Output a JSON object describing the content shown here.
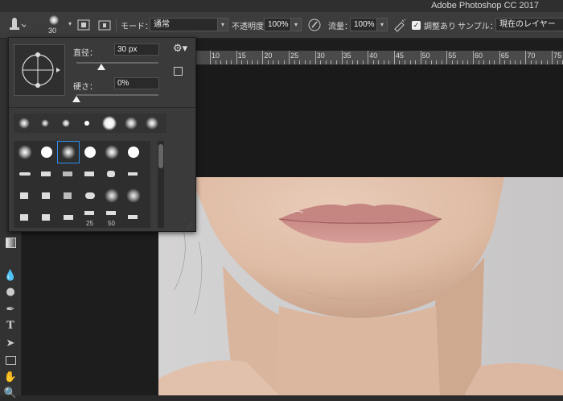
{
  "app": {
    "title": "Adobe Photoshop CC 2017"
  },
  "options_bar": {
    "brush_size": "30",
    "mode_label": "モード：",
    "mode_value": "通常",
    "opacity_label": "不透明度：",
    "opacity_value": "100%",
    "flow_label": "流量：",
    "flow_value": "100%",
    "aligned_label": "調整あり",
    "sample_label": "サンプル：",
    "sample_value": "現在のレイヤー"
  },
  "brush_panel": {
    "diameter_label": "直径：",
    "diameter_value": "30 px",
    "hardness_label": "硬さ：",
    "hardness_value": "0%",
    "diameter_fraction": 0.3,
    "hardness_fraction": 0.0,
    "numbers": [
      "25",
      "50"
    ]
  },
  "ruler": {
    "labels": [
      "10",
      "15",
      "20",
      "25",
      "30",
      "35",
      "40",
      "45",
      "50",
      "55",
      "60",
      "65",
      "70",
      "75"
    ]
  },
  "colors": {
    "panel_bg": "#3a3a3a",
    "selected_outline": "#2d8ceb",
    "skin": "#e3c2ad"
  }
}
